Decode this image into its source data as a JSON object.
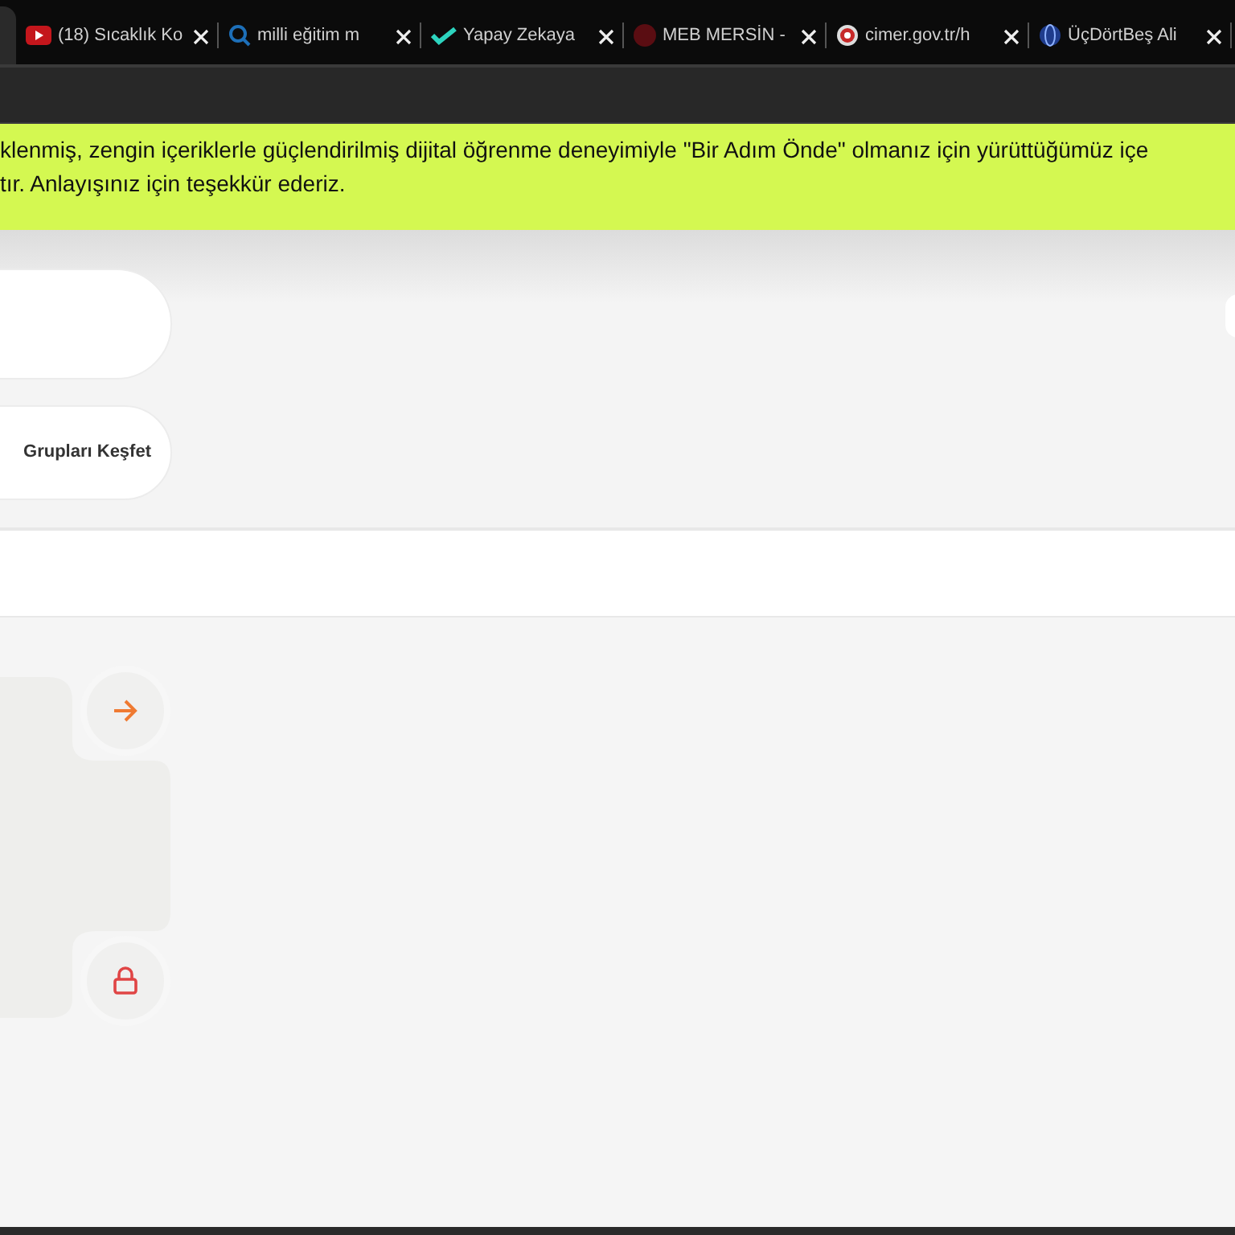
{
  "browser_tabs": [
    {
      "title": "(18) Sıcaklık Ko",
      "selected": false,
      "kind": "youtube"
    },
    {
      "title": "milli eğitim m",
      "selected": false,
      "kind": "search"
    },
    {
      "title": "Yapay Zekaya",
      "selected": false,
      "kind": "check"
    },
    {
      "title": "MEB MERSİN -",
      "selected": false,
      "kind": "meb"
    },
    {
      "title": "cimer.gov.tr/h",
      "selected": false,
      "kind": "cimer"
    },
    {
      "title": "ÜçDörtBeş Ali",
      "selected": false,
      "kind": "globe"
    }
  ],
  "banner": {
    "lines": [
      "klenmiş, zengin içeriklerle güçlendirilmiş dijital öğrenme deneyimiyle \"Bir Adım Önde\" olmanız için yürüttüğümüz içe",
      "tır. Anlayışınız için teşekkür ederiz."
    ]
  },
  "nav_buttons": [
    {
      "label": "Grupları Keşfet"
    }
  ],
  "card_actions": [
    {
      "kind": "arrow"
    },
    {
      "kind": "lock"
    }
  ]
}
